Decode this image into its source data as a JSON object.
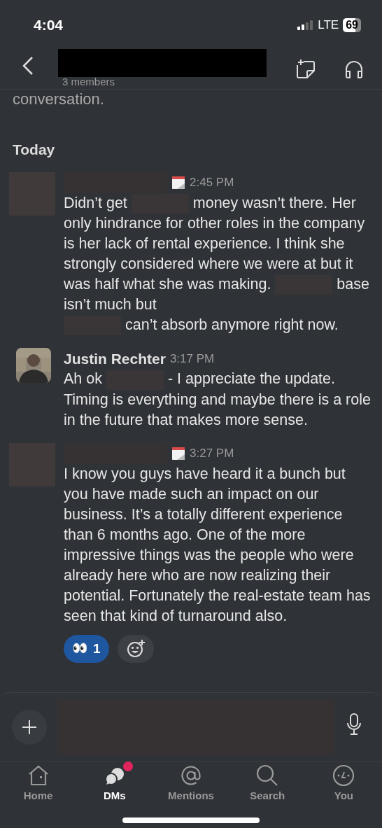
{
  "status_bar": {
    "time": "4:04",
    "network": "LTE",
    "battery": "69"
  },
  "header": {
    "title_redacted": true,
    "subtitle": "3 members"
  },
  "intro_tail": "conversation.",
  "day_divider": "Today",
  "messages": [
    {
      "kind": "redacted",
      "time": "2:45 PM",
      "status_icon": true,
      "body": [
        {
          "kind": "text",
          "text": "Didn’t get"
        },
        {
          "kind": "redacted"
        },
        {
          "kind": "text",
          "text": "money wasn’t there. Her only hindrance for other roles in the company is her lack of rental experience. I think she strongly considered where we were at but it was half what she was making."
        },
        {
          "kind": "redacted"
        },
        {
          "kind": "text",
          "text": "base isn’t much but"
        },
        {
          "kind": "break"
        },
        {
          "kind": "redacted"
        },
        {
          "kind": "text",
          "text": "can’t absorb anymore right now."
        }
      ]
    },
    {
      "kind": "named",
      "name": "Justin Rechter",
      "time": "3:17 PM",
      "status_icon": false,
      "body": [
        {
          "kind": "text",
          "text": "Ah ok"
        },
        {
          "kind": "redacted"
        },
        {
          "kind": "text",
          "text": "- I appreciate the update. Timing is everything and maybe there is a role in the future that makes more sense."
        }
      ]
    },
    {
      "kind": "redacted",
      "time": "3:27 PM",
      "status_icon": true,
      "body": [
        {
          "kind": "text",
          "text": "I know you guys have heard it a bunch but you have made such an impact on our business. It’s a totally different experience than 6 months ago. One of the more impressive things was the people who were already here who are now realizing their potential. Fortunately the real-estate team has seen that kind of turnaround also."
        }
      ],
      "reactions": [
        {
          "emoji": "👀",
          "count": "1",
          "selected": true
        }
      ]
    }
  ],
  "composer": {
    "redacted": true
  },
  "tabs": [
    {
      "label": "Home",
      "selected": false,
      "badge": false
    },
    {
      "label": "DMs",
      "selected": true,
      "badge": true
    },
    {
      "label": "Mentions",
      "selected": false,
      "badge": false
    },
    {
      "label": "Search",
      "selected": false,
      "badge": false
    },
    {
      "label": "You",
      "selected": false,
      "badge": false
    }
  ]
}
